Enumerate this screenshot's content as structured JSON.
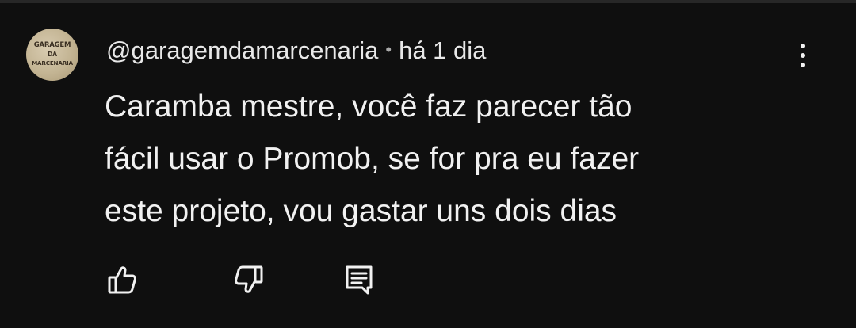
{
  "comment": {
    "avatar": {
      "lines": [
        "GARAGEM",
        "DA",
        "MARCENARIA"
      ]
    },
    "author": "@garagemdamarcenaria",
    "separator": "•",
    "time": "há 1 dia",
    "text_lines": [
      "Caramba mestre, você faz parecer tão",
      "fácil usar o Promob, se for pra eu fazer",
      "este projeto, vou gastar uns dois dias"
    ],
    "actions": {
      "like_icon": "thumbs-up-icon",
      "dislike_icon": "thumbs-down-icon",
      "reply_icon": "reply-comment-icon",
      "more_icon": "more-vertical-icon"
    }
  },
  "colors": {
    "background": "#0f0f0f",
    "primary_text": "#f1f1f1",
    "secondary_text": "#aaaaaa"
  }
}
